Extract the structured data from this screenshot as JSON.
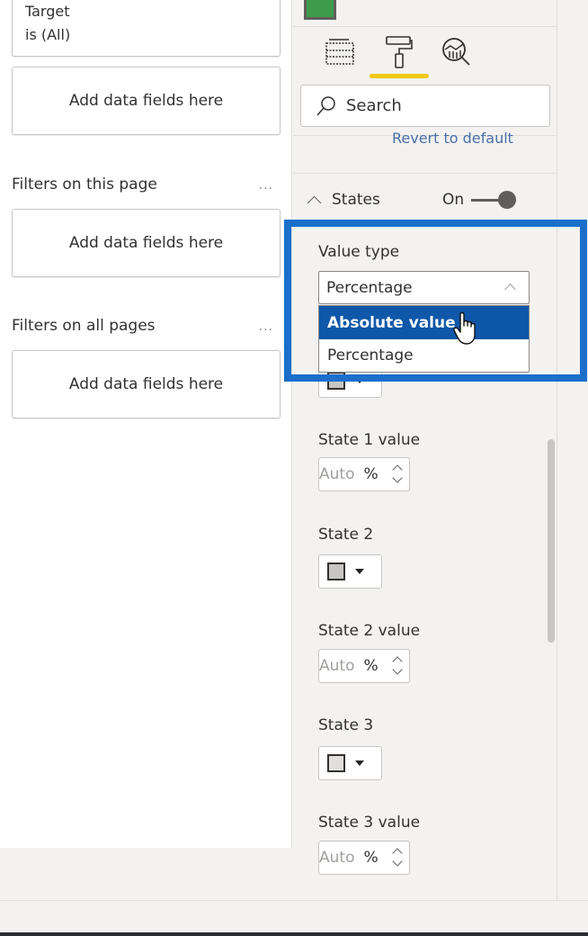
{
  "filters": {
    "visual_filter": {
      "field": "Target",
      "condition": "is (All)"
    },
    "visual_drop_zone": "Add data fields here",
    "page_section": {
      "title": "Filters on this page",
      "more": "...",
      "drop_zone": "Add data fields here"
    },
    "all_pages_section": {
      "title": "Filters on all pages",
      "more": "...",
      "drop_zone": "Add data fields here"
    }
  },
  "format_pane": {
    "tabs": [
      {
        "name": "fields",
        "icon": "fields-icon",
        "active": false
      },
      {
        "name": "format",
        "icon": "paint-roller-icon",
        "active": true
      },
      {
        "name": "analytics",
        "icon": "analytics-icon",
        "active": false
      }
    ],
    "accent_color": "#f2c811",
    "search": {
      "placeholder": "Search",
      "value": ""
    },
    "revert_label": "Revert to default",
    "states_section": {
      "title": "States",
      "toggle_label": "On",
      "toggle_on": true
    },
    "value_type": {
      "label": "Value type",
      "selected": "Percentage",
      "options": [
        "Absolute value",
        "Percentage"
      ],
      "hovered_option": "Absolute value"
    },
    "state_fields": [
      {
        "value_label": "State 1 value",
        "value_placeholder": "Auto",
        "unit": "%"
      },
      {
        "color_label": "State 2",
        "value_label": "State 2 value",
        "value_placeholder": "Auto",
        "unit": "%"
      },
      {
        "color_label": "State 3",
        "value_label": "State 3 value",
        "value_placeholder": "Auto",
        "unit": "%"
      }
    ],
    "highlight_color": "#1a6fcb",
    "selection_color": "#0f57a8"
  }
}
